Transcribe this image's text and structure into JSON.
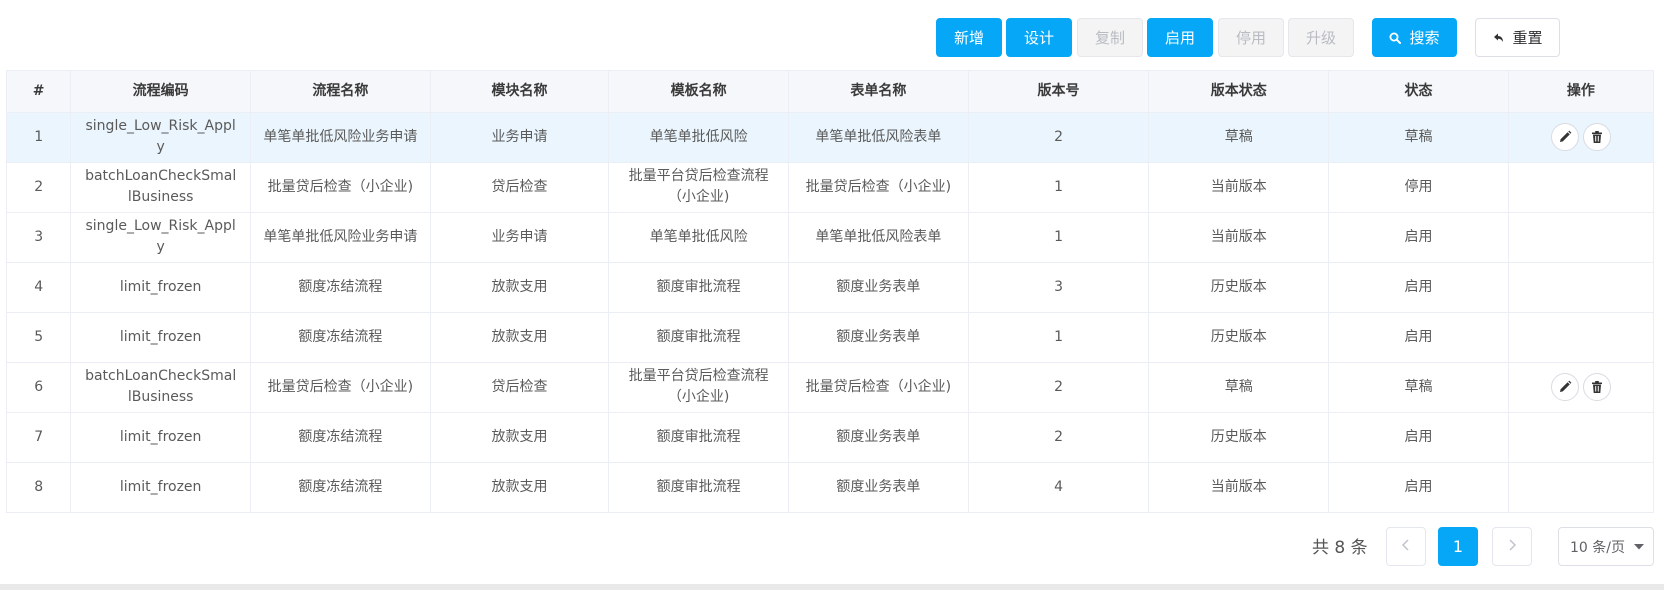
{
  "toolbar": {
    "add_label": "新增",
    "design_label": "设计",
    "copy_label": "复制",
    "enable_label": "启用",
    "disable_label": "停用",
    "upgrade_label": "升级",
    "search_label": "搜索",
    "reset_label": "重置"
  },
  "table": {
    "headers": [
      "#",
      "流程编码",
      "流程名称",
      "模块名称",
      "模板名称",
      "表单名称",
      "版本号",
      "版本状态",
      "状态",
      "操作"
    ],
    "rows": [
      [
        "1",
        "single_Low_Risk_Apply",
        "单笔单批低风险业务申请",
        "业务申请",
        "单笔单批低风险",
        "单笔单批低风险表单",
        "2",
        "草稿",
        "草稿"
      ],
      [
        "2",
        "batchLoanCheckSmallBusiness",
        "批量贷后检查（小企业)",
        "贷后检查",
        "批量平台贷后检查流程（小企业)",
        "批量贷后检查（小企业)",
        "1",
        "当前版本",
        "停用"
      ],
      [
        "3",
        "single_Low_Risk_Apply",
        "单笔单批低风险业务申请",
        "业务申请",
        "单笔单批低风险",
        "单笔单批低风险表单",
        "1",
        "当前版本",
        "启用"
      ],
      [
        "4",
        "limit_frozen",
        "额度冻结流程",
        "放款支用",
        "额度审批流程",
        "额度业务表单",
        "3",
        "历史版本",
        "启用"
      ],
      [
        "5",
        "limit_frozen",
        "额度冻结流程",
        "放款支用",
        "额度审批流程",
        "额度业务表单",
        "1",
        "历史版本",
        "启用"
      ],
      [
        "6",
        "batchLoanCheckSmallBusiness",
        "批量贷后检查（小企业)",
        "贷后检查",
        "批量平台贷后检查流程（小企业)",
        "批量贷后检查（小企业)",
        "2",
        "草稿",
        "草稿"
      ],
      [
        "7",
        "limit_frozen",
        "额度冻结流程",
        "放款支用",
        "额度审批流程",
        "额度业务表单",
        "2",
        "历史版本",
        "启用"
      ],
      [
        "8",
        "limit_frozen",
        "额度冻结流程",
        "放款支用",
        "额度审批流程",
        "额度业务表单",
        "4",
        "当前版本",
        "启用"
      ]
    ],
    "editable_rows": [
      0,
      5
    ],
    "selected_row": 0
  },
  "pagination": {
    "total_label": "共 8 条",
    "current_page": "1",
    "page_size_label": "10 条/页"
  },
  "colors": {
    "primary": "#06a7f7",
    "selected_row": "#eaf5fd",
    "header_bg": "#f5f7fa",
    "border": "#ebeef5"
  },
  "icons": {
    "search": "search-icon",
    "reset": "undo-arrow-icon",
    "edit": "pencil-icon",
    "delete": "trash-icon",
    "prev": "chevron-left-icon",
    "next": "chevron-right-icon",
    "dropdown": "caret-down-icon"
  }
}
